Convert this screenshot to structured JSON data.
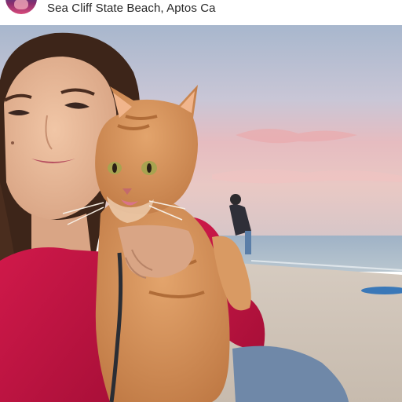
{
  "post": {
    "location": "Sea Cliff State Beach, Aptos Ca"
  },
  "photo": {
    "subject": "photo-selfie-with-cat",
    "colors": {
      "sky_top": "#a9b8cf",
      "sky_pink": "#e7b6b8",
      "ocean": "#8ea9bd",
      "sand": "#cfc4b9",
      "shirt": "#c4143f",
      "cat_fur": "#d3905a",
      "hair": "#3b2218",
      "jeans": "#6f88a8"
    }
  }
}
